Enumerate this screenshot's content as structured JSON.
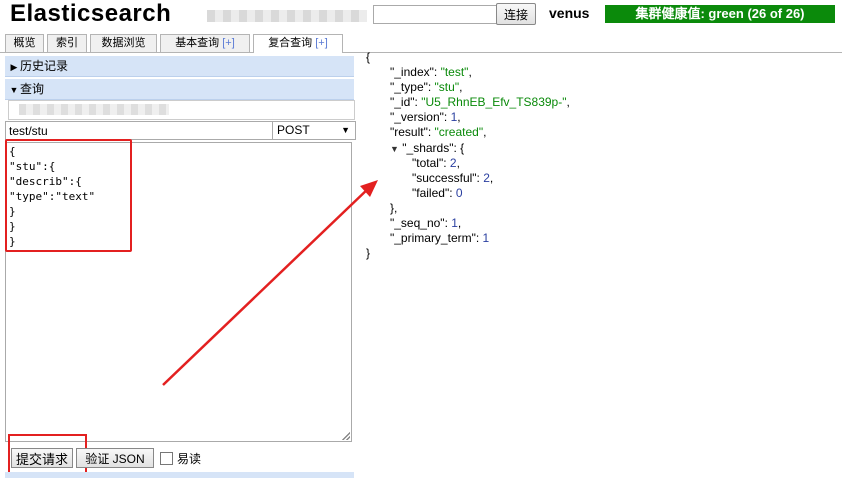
{
  "header": {
    "title": "Elasticsearch",
    "connect_label": "连接",
    "cluster_name": "venus",
    "health_text": "集群健康值: green (26 of 26)"
  },
  "tabs": [
    {
      "label": "概览"
    },
    {
      "label": "索引"
    },
    {
      "label": "数据浏览"
    },
    {
      "label": "基本查询",
      "plus": "[+]"
    },
    {
      "label": "复合查询",
      "plus": "[+]"
    }
  ],
  "query": {
    "history_label": "历史记录",
    "query_label": "查询",
    "path": "test/stu",
    "method": "POST",
    "body_lines": [
      "{",
      "\"stu\":{",
      "\"describ\":{",
      "\"type\":\"text\"",
      "}",
      "}",
      "}"
    ],
    "submit_label": "提交请求",
    "validate_label": "验证 JSON",
    "pretty_label": "易读"
  },
  "response": {
    "open": "{",
    "index_key": "\"_index\"",
    "index_val": "\"test\"",
    "type_key": "\"_type\"",
    "type_val": "\"stu\"",
    "id_key": "\"_id\"",
    "id_val": "\"U5_RhnEB_Efv_TS839p-\"",
    "version_key": "\"_version\"",
    "version_val": "1",
    "result_key": "\"result\"",
    "result_val": "\"created\"",
    "shards_key": "\"_shards\"",
    "total_key": "\"total\"",
    "total_val": "2",
    "successful_key": "\"successful\"",
    "successful_val": "2",
    "failed_key": "\"failed\"",
    "failed_val": "0",
    "shards_close": "},",
    "seq_key": "\"_seq_no\"",
    "seq_val": "1",
    "primary_key": "\"_primary_term\"",
    "primary_val": "1",
    "close": "}"
  },
  "colors": {
    "health_green": "#0b8a0b",
    "annotation_red": "#e32020",
    "section_blue": "#d6e4f7"
  }
}
